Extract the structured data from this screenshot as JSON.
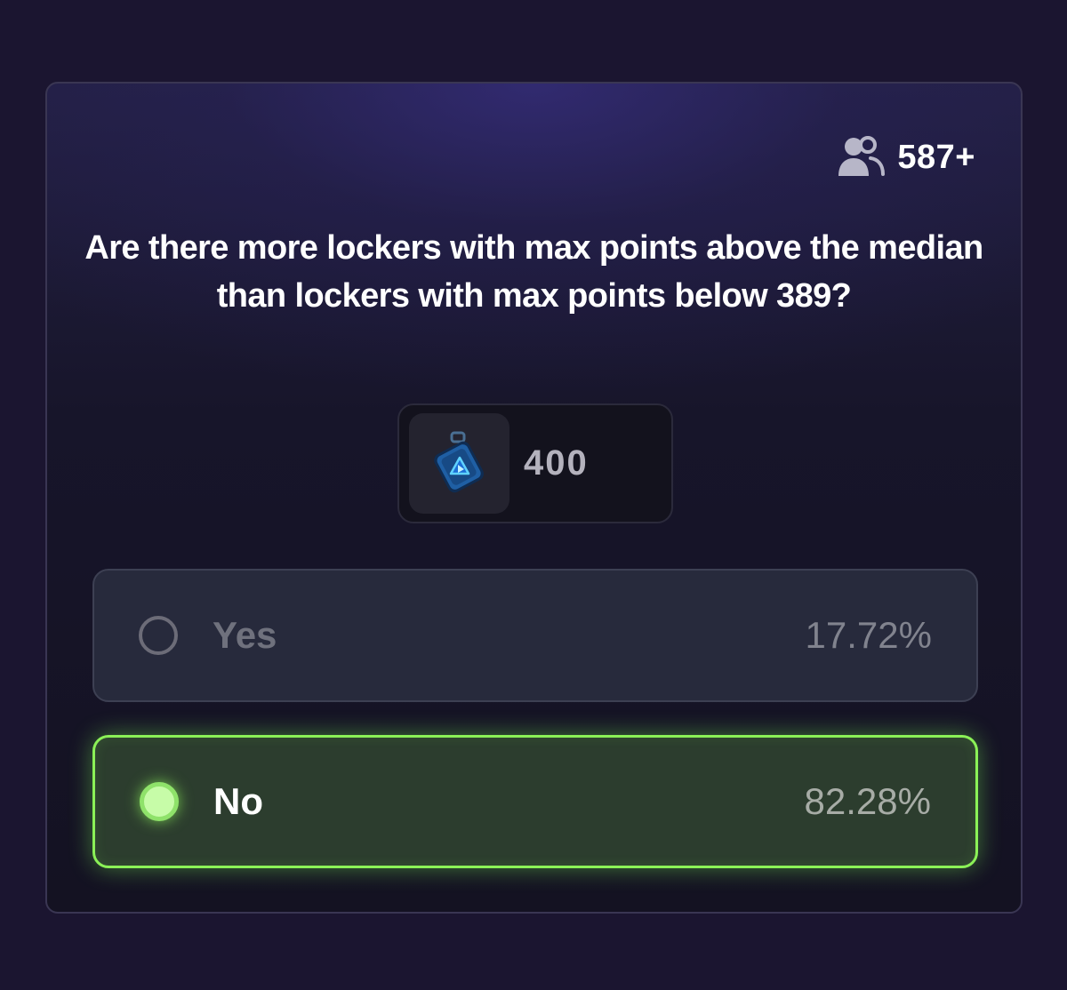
{
  "participants": {
    "icon": "users-icon",
    "count": "587+"
  },
  "question": "Are there more lockers with max points above the median than lockers with max points below 389?",
  "reward": {
    "icon": "locker-token-icon",
    "value": "400"
  },
  "options": [
    {
      "label": "Yes",
      "percent": "17.72%",
      "selected": false
    },
    {
      "label": "No",
      "percent": "82.28%",
      "selected": true
    }
  ],
  "colors": {
    "background": "#1b1530",
    "accent_green": "#8bf157",
    "selected_fill": "#2c3d2e",
    "unselected_fill": "#272a3c"
  }
}
